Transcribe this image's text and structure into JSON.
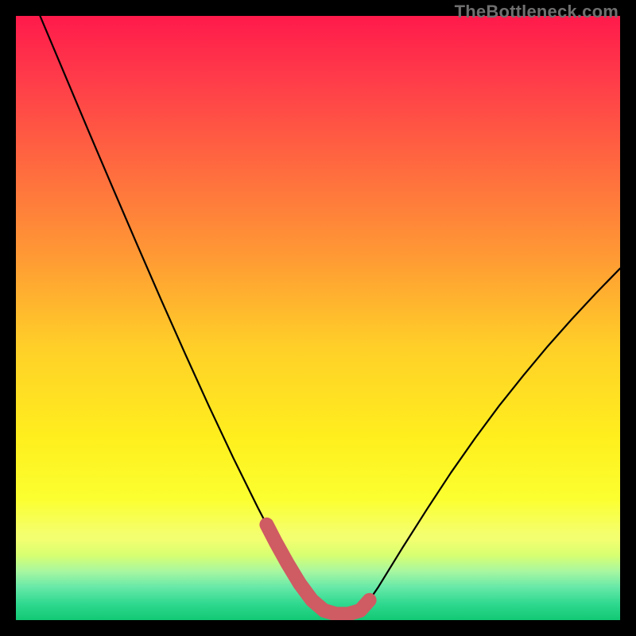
{
  "watermark": "TheBottleneck.com",
  "chart_data": {
    "type": "line",
    "title": "",
    "xlabel": "",
    "ylabel": "",
    "xlim": [
      0,
      100
    ],
    "ylim": [
      0,
      100
    ],
    "grid": false,
    "series": [
      {
        "name": "bottleneck-curve",
        "x": [
          4,
          8,
          12,
          16,
          20,
          24,
          28,
          32,
          36,
          40,
          41.5,
          43,
          45,
          47,
          49,
          51,
          53,
          55,
          57,
          58.5,
          60,
          64,
          68,
          72,
          76,
          80,
          84,
          88,
          92,
          96,
          100
        ],
        "values": [
          100,
          90.5,
          81,
          71.6,
          62.3,
          53.1,
          44.1,
          35.3,
          26.8,
          18.7,
          15.8,
          12.9,
          9.3,
          6,
          3.3,
          1.6,
          1.0,
          1.0,
          1.6,
          3.3,
          5.5,
          12.0,
          18.3,
          24.4,
          30.1,
          35.5,
          40.5,
          45.3,
          49.8,
          54.1,
          58.2
        ]
      }
    ],
    "highlight": {
      "name": "bottom-band",
      "x": [
        41.5,
        43,
        45,
        47,
        49,
        51,
        53,
        55,
        57,
        58.5
      ],
      "values": [
        15.8,
        12.9,
        9.3,
        6,
        3.3,
        1.6,
        1.0,
        1.0,
        1.6,
        3.3
      ]
    },
    "green_band_top_fraction": 0.135
  }
}
